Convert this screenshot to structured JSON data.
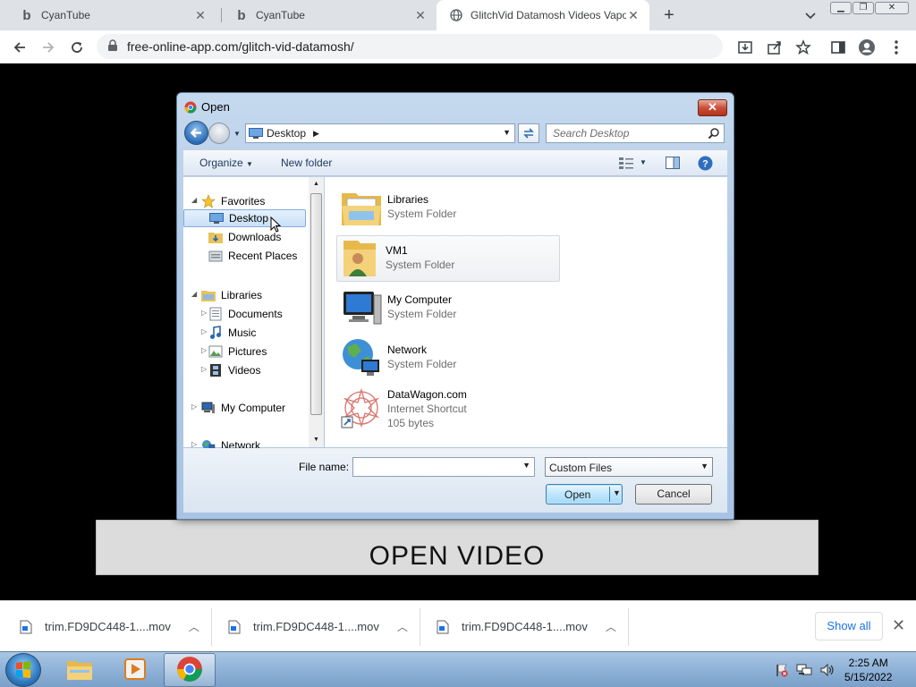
{
  "browser": {
    "tabs": [
      {
        "title": "CyanTube",
        "active": false
      },
      {
        "title": "CyanTube",
        "active": false
      },
      {
        "title": "GlitchVid Datamosh Videos Vapo",
        "active": true
      }
    ],
    "url": "free-online-app.com/glitch-vid-datamosh/"
  },
  "page": {
    "open_video_label": "OPEN VIDEO"
  },
  "dialog": {
    "title": "Open",
    "location": "Desktop",
    "search_placeholder": "Search Desktop",
    "commands": {
      "organize": "Organize",
      "new_folder": "New folder"
    },
    "nav": {
      "favorites": "Favorites",
      "desktop": "Desktop",
      "downloads": "Downloads",
      "recent_places": "Recent Places",
      "libraries": "Libraries",
      "documents": "Documents",
      "music": "Music",
      "pictures": "Pictures",
      "videos": "Videos",
      "my_computer": "My Computer",
      "network": "Network"
    },
    "files": [
      {
        "name": "Libraries",
        "type": "System Folder",
        "size": ""
      },
      {
        "name": "VM1",
        "type": "System Folder",
        "size": ""
      },
      {
        "name": "My Computer",
        "type": "System Folder",
        "size": ""
      },
      {
        "name": "Network",
        "type": "System Folder",
        "size": ""
      },
      {
        "name": "DataWagon.com",
        "type": "Internet Shortcut",
        "size": "105 bytes"
      }
    ],
    "file_name_label": "File name:",
    "file_name_value": "",
    "filter": "Custom Files",
    "open_button": "Open",
    "cancel_button": "Cancel"
  },
  "downloads": {
    "items": [
      {
        "name": "trim.FD9DC448-1....mov"
      },
      {
        "name": "trim.FD9DC448-1....mov"
      },
      {
        "name": "trim.FD9DC448-1....mov"
      }
    ],
    "show_all": "Show all"
  },
  "taskbar": {
    "time": "2:25 AM",
    "date": "5/15/2022"
  },
  "colors": {
    "chrome_tabstrip": "#dee1e6",
    "dialog_frame": "#b3cbe6",
    "selection": "#c9e0f7",
    "link_blue": "#1a73e8"
  }
}
